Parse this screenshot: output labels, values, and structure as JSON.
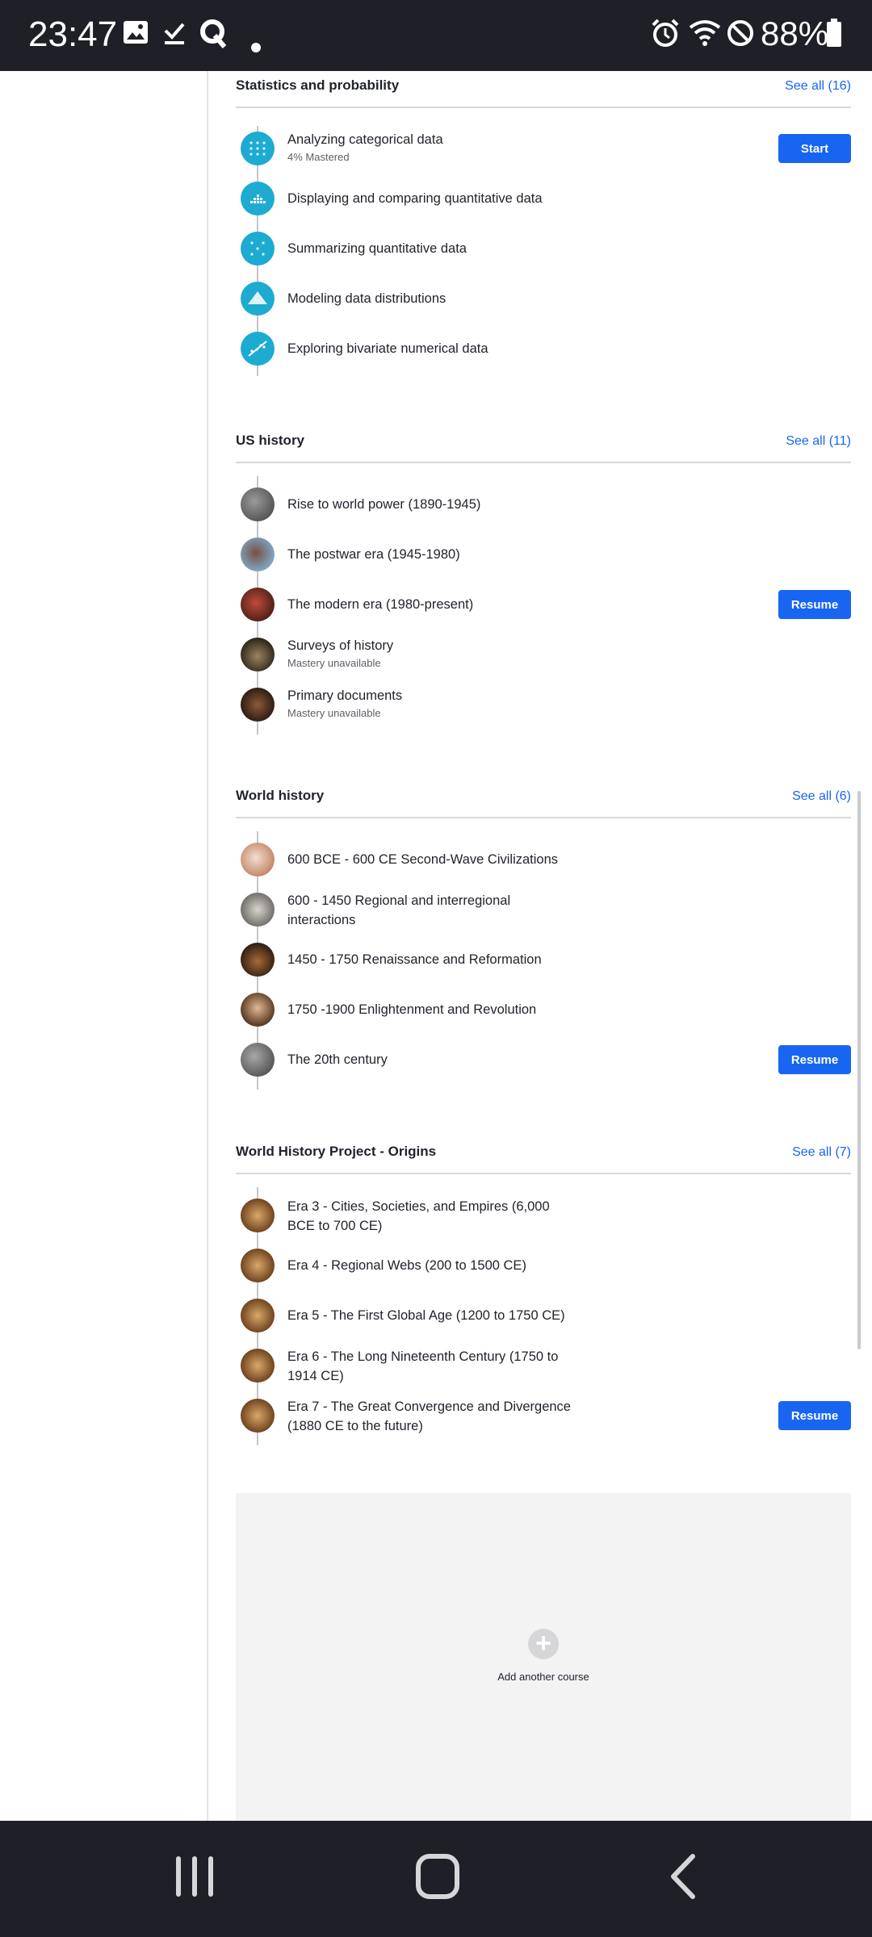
{
  "status_bar": {
    "time": "23:47",
    "battery": "88%",
    "icons": [
      "image-icon",
      "download-done-icon",
      "q-app-icon",
      "dot-icon",
      "alarm-icon",
      "wifi-icon",
      "do-not-disturb-icon",
      "battery-icon"
    ]
  },
  "sections": [
    {
      "title": "Statistics and probability",
      "see_all": "See all (16)",
      "units": [
        {
          "title": "Analyzing categorical data",
          "subtitle": "4% Mastered",
          "button": "Start"
        },
        {
          "title": "Displaying and comparing quantitative data"
        },
        {
          "title": "Summarizing quantitative data"
        },
        {
          "title": "Modeling data distributions"
        },
        {
          "title": "Exploring bivariate numerical data"
        }
      ]
    },
    {
      "title": "US history",
      "see_all": "See all (11)",
      "units": [
        {
          "title": "Rise to world power (1890-1945)"
        },
        {
          "title": "The postwar era (1945-1980)"
        },
        {
          "title": "The modern era (1980-present)",
          "button": "Resume"
        },
        {
          "title": "Surveys of history",
          "subtitle": "Mastery unavailable"
        },
        {
          "title": "Primary documents",
          "subtitle": "Mastery unavailable"
        }
      ]
    },
    {
      "title": "World history",
      "see_all": "See all (6)",
      "units": [
        {
          "title": "600 BCE - 600 CE Second-Wave Civilizations"
        },
        {
          "title": "600 - 1450 Regional and interregional interactions"
        },
        {
          "title": "1450 - 1750 Renaissance and Reformation"
        },
        {
          "title": "1750 -1900 Enlightenment and Revolution"
        },
        {
          "title": "The 20th century",
          "button": "Resume"
        }
      ]
    },
    {
      "title": "World History Project - Origins",
      "see_all": "See all (7)",
      "units": [
        {
          "title": "Era 3 - Cities, Societies, and Empires (6,000 BCE to 700 CE)"
        },
        {
          "title": "Era 4 - Regional Webs (200 to 1500 CE)"
        },
        {
          "title": "Era 5 - The First Global Age (1200 to 1750 CE)"
        },
        {
          "title": "Era 6 - The Long Nineteenth Century (1750 to 1914 CE)"
        },
        {
          "title": "Era 7 - The Great Convergence and Divergence (1880 CE to the future)",
          "button": "Resume"
        }
      ]
    }
  ],
  "add_course": {
    "label": "Add another course"
  },
  "nav_bar": {
    "icons": [
      "recent-apps-icon",
      "home-icon",
      "back-icon"
    ]
  },
  "colors": {
    "accent": "#1865f2",
    "stats_icon": "#1dabd2",
    "system_bar": "#1f2027"
  }
}
